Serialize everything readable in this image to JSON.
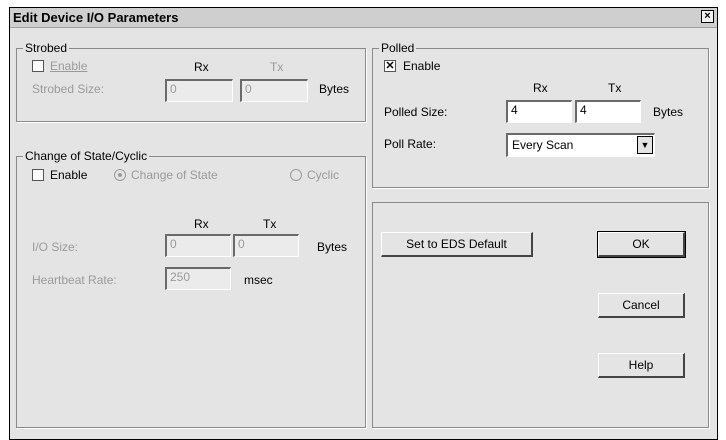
{
  "window": {
    "title": "Edit Device I/O Parameters",
    "close_glyph": "×"
  },
  "strobed": {
    "legend": "Strobed",
    "enable_label": "Enable",
    "enable_checked": false,
    "rx_header": "Rx",
    "tx_header": "Tx",
    "size_label": "Strobed Size:",
    "rx_value": "0",
    "tx_value": "0",
    "units": "Bytes"
  },
  "polled": {
    "legend": "Polled",
    "enable_label": "Enable",
    "enable_checked": true,
    "enable_mark": "✕",
    "rx_header": "Rx",
    "tx_header": "Tx",
    "size_label": "Polled Size:",
    "rx_value": "4",
    "tx_value": "4",
    "units": "Bytes",
    "rate_label": "Poll Rate:",
    "rate_value": "Every Scan",
    "rate_arrow": "▼"
  },
  "cos": {
    "legend": "Change of State/Cyclic",
    "enable_label": "Enable",
    "enable_checked": false,
    "option_cos": "Change of State",
    "option_cyclic": "Cyclic",
    "selected_option": "Change of State",
    "rx_header": "Rx",
    "tx_header": "Tx",
    "io_size_label": "I/O Size:",
    "rx_value": "0",
    "tx_value": "0",
    "units": "Bytes",
    "heartbeat_label": "Heartbeat Rate:",
    "heartbeat_value": "250",
    "heartbeat_units": "msec"
  },
  "buttons": {
    "eds_default": "Set to EDS Default",
    "ok": "OK",
    "cancel": "Cancel",
    "help": "Help"
  }
}
